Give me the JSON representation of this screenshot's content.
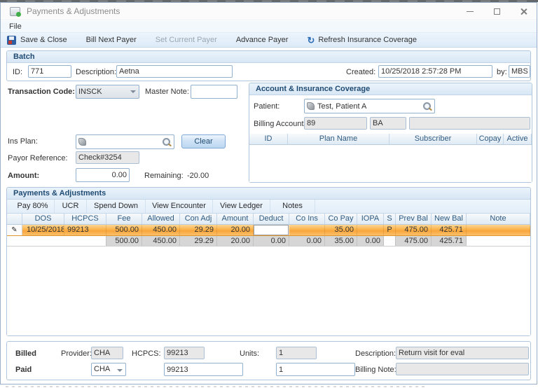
{
  "window": {
    "title": "Payments & Adjustments"
  },
  "menu": {
    "file": "File"
  },
  "toolbar": {
    "save_close": "Save & Close",
    "bill_next_payer": "Bill Next Payer",
    "set_current_payer": "Set Current Payer",
    "advance_payer": "Advance Payer",
    "refresh_insurance": "Refresh Insurance Coverage"
  },
  "batch": {
    "title": "Batch",
    "id_label": "ID:",
    "id_value": "771",
    "description_label": "Description:",
    "description_value": "Aetna",
    "created_label": "Created:",
    "created_value": "10/25/2018 2:57:28 PM",
    "by_label": "by:",
    "by_value": "MBS"
  },
  "transaction": {
    "code_label": "Transaction Code:",
    "code_value": "INSCK",
    "master_note_label": "Master Note:",
    "master_note_value": "",
    "ins_plan_label": "Ins Plan:",
    "ins_plan_value": "",
    "clear_button": "Clear",
    "payor_reference_label": "Payor Reference:",
    "payor_reference_value": "Check#3254",
    "amount_label": "Amount:",
    "amount_value": "0.00",
    "remaining_label": "Remaining:",
    "remaining_value": "-20.00"
  },
  "account": {
    "title": "Account & Insurance Coverage",
    "patient_label": "Patient:",
    "patient_value": "Test, Patient A",
    "billing_account_label": "Billing Account:",
    "billing_account_id": "89",
    "billing_account_code": "BA",
    "billing_account_name": "",
    "columns": [
      "ID",
      "Plan Name",
      "Subscriber",
      "Copay",
      "Active"
    ]
  },
  "payments": {
    "title": "Payments & Adjustments",
    "actions": {
      "pay80": "Pay 80%",
      "ucr": "UCR",
      "spend_down": "Spend Down",
      "view_encounter": "View Encounter",
      "view_ledger": "View Ledger",
      "notes": "Notes"
    },
    "columns": [
      "DOS",
      "HCPCS",
      "Fee",
      "Allowed",
      "Con Adj",
      "Amount",
      "Deduct",
      "Co Ins",
      "Co Pay",
      "IOPA",
      "S",
      "Prev Bal",
      "New Bal",
      "Note"
    ],
    "row": [
      "10/25/2018",
      "99213",
      "500.00",
      "450.00",
      "29.29",
      "20.00",
      "",
      "",
      "35.00",
      "",
      "P",
      "475.00",
      "425.71",
      ""
    ],
    "totals": [
      "",
      "",
      "500.00",
      "450.00",
      "29.29",
      "20.00",
      "0.00",
      "0.00",
      "35.00",
      "0.00",
      "",
      "475.00",
      "425.71",
      ""
    ]
  },
  "billed": {
    "label": "Billed",
    "provider_label": "Provider:",
    "provider_value": "CHA",
    "hcpcs_label": "HCPCS:",
    "hcpcs_value": "99213",
    "units_label": "Units:",
    "units_value": "1",
    "description_label": "Description:",
    "description_value": "Return visit for eval"
  },
  "paid": {
    "label": "Paid",
    "provider_value": "CHA",
    "hcpcs_value": "99213",
    "units_value": "1",
    "billing_note_label": "Billing Note:",
    "billing_note_value": ""
  },
  "colors": {
    "selected_row_orange": "#F9A63C",
    "group_header_text": "#1F4A72",
    "toolbar_bg": "#E2EEF9"
  }
}
